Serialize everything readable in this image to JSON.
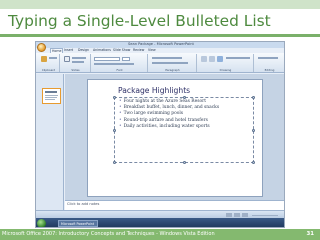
{
  "slide": {
    "title": "Typing a Single-Level Bulleted List",
    "footer": "Microsoft Office 2007: Introductory Concepts and Techniques - Windows Vista Edition",
    "page_number": "31"
  },
  "powerpoint": {
    "window_title": "Sean Package - Microsoft PowerPoint",
    "tabs": [
      "Home",
      "Insert",
      "Design",
      "Animations",
      "Slide Show",
      "Review",
      "View"
    ],
    "active_tab": "Home",
    "ribbon_groups": [
      "Clipboard",
      "Slides",
      "Font",
      "Paragraph",
      "Drawing",
      "Editing"
    ],
    "slide_title": "Package Highlights",
    "bullets": [
      "Four nights at the Azure Seas Resort",
      "Breakfast buffet, lunch, dinner, and snacks",
      "Two large swimming pools",
      "Round-trip airfare and hotel transfers",
      "Daily activities, including water sports"
    ],
    "notes_placeholder": "Click to add notes",
    "taskbar_item": "Microsoft PowerPoint"
  },
  "colors": {
    "title_green": "#4e8a3f",
    "footer_green": "#84b96f",
    "band_green": "#cfe3c9"
  }
}
